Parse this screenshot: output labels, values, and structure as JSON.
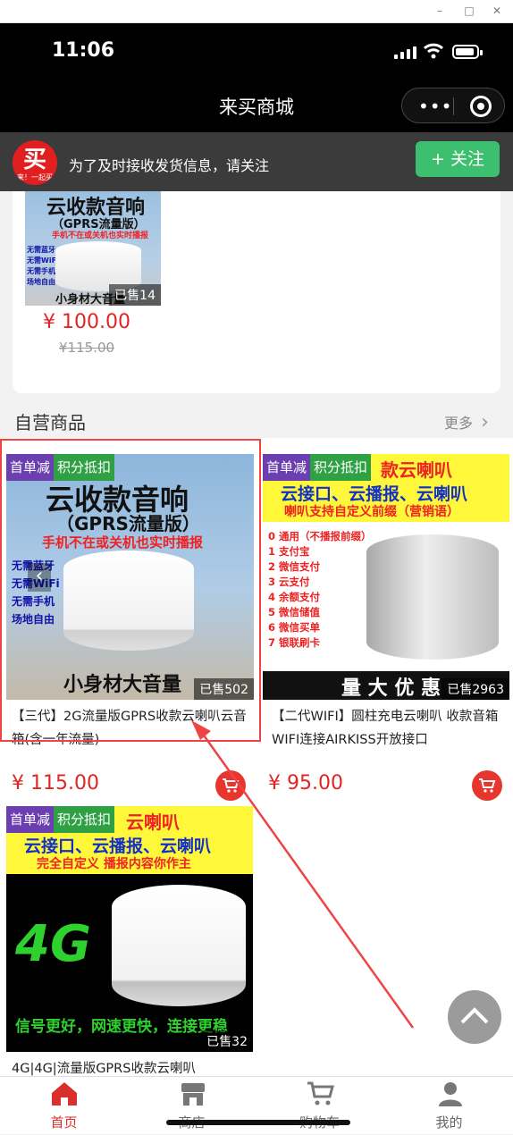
{
  "window": {
    "minimize": "–",
    "maximize": "□",
    "close": "✕"
  },
  "status_bar": {
    "time": "11:06"
  },
  "navbar": {
    "title": "来买商城"
  },
  "follow_bar": {
    "logo_char": "买",
    "logo_sub": "来！一起买",
    "text": "为了及时接收发货信息，请关注",
    "button": "关注",
    "button_icon": "+"
  },
  "top_product": {
    "img_line1": "云收款音响",
    "img_line2": "（GPRS流量版）",
    "img_line3": "手机不在或关机也实时播报",
    "img_side": [
      "无需蓝牙",
      "无需WiFi",
      "无需手机",
      "场地自由"
    ],
    "img_bottom": "小身材大音量",
    "sold": "已售14",
    "price": "¥ 100.00",
    "old_price": "¥115.00"
  },
  "section": {
    "title": "自营商品",
    "more": "更多"
  },
  "products": [
    {
      "badge1": "首单减",
      "badge2": "积分抵扣",
      "img_line1": "云收款音响",
      "img_line2": "（GPRS流量版）",
      "img_line3": "手机不在或关机也实时播报",
      "img_side": [
        "无需蓝牙",
        "无需WiFi",
        "无需手机",
        "场地自由"
      ],
      "img_bottom": "小身材大音量",
      "sold": "已售502",
      "title": "【三代】2G流量版GPRS收款云喇叭云音箱(含一年流量)",
      "price": "¥ 115.00"
    },
    {
      "badge1": "首单减",
      "badge2": "积分抵扣",
      "img_top": "款云喇叭",
      "img_line1": "云接口、云播报、云喇叭",
      "img_line2": "喇叭支持自定义前缀（营销语）",
      "img_list": [
        "0 通用（不播报前缀）",
        "1 支付宝",
        "2 微信支付",
        "3 云支付",
        "4 余额支付",
        "5 微信储值",
        "6 微信买单",
        "7 银联刷卡"
      ],
      "img_bottom": "量 大 优 惠",
      "sold": "已售2963",
      "title": "【二代WIFI】圆柱充电云喇叭 收款音箱WIFI连接AIRKISS开放接口",
      "price": "¥ 95.00"
    },
    {
      "badge1": "首单减",
      "badge2": "积分抵扣",
      "img_top": "云喇叭",
      "img_line1": "云接口、云播报、云喇叭",
      "img_line2": "完全自定义  播报内容你作主",
      "img_big": "4G",
      "img_bottom": "信号更好，网速更快，连接更稳",
      "sold": "已售32",
      "title": "4G|4G|流量版GPRS收款云喇叭"
    }
  ],
  "tabbar": [
    {
      "label": "首页",
      "icon": "home-icon",
      "active": true
    },
    {
      "label": "商店",
      "icon": "store-icon"
    },
    {
      "label": "购物车",
      "icon": "cart-icon"
    },
    {
      "label": "我的",
      "icon": "user-icon"
    }
  ],
  "colors": {
    "accent": "#e02525",
    "follow_green": "#3cbf6e",
    "badge_purple": "#6c3fb1",
    "badge_green": "#2fa044"
  }
}
